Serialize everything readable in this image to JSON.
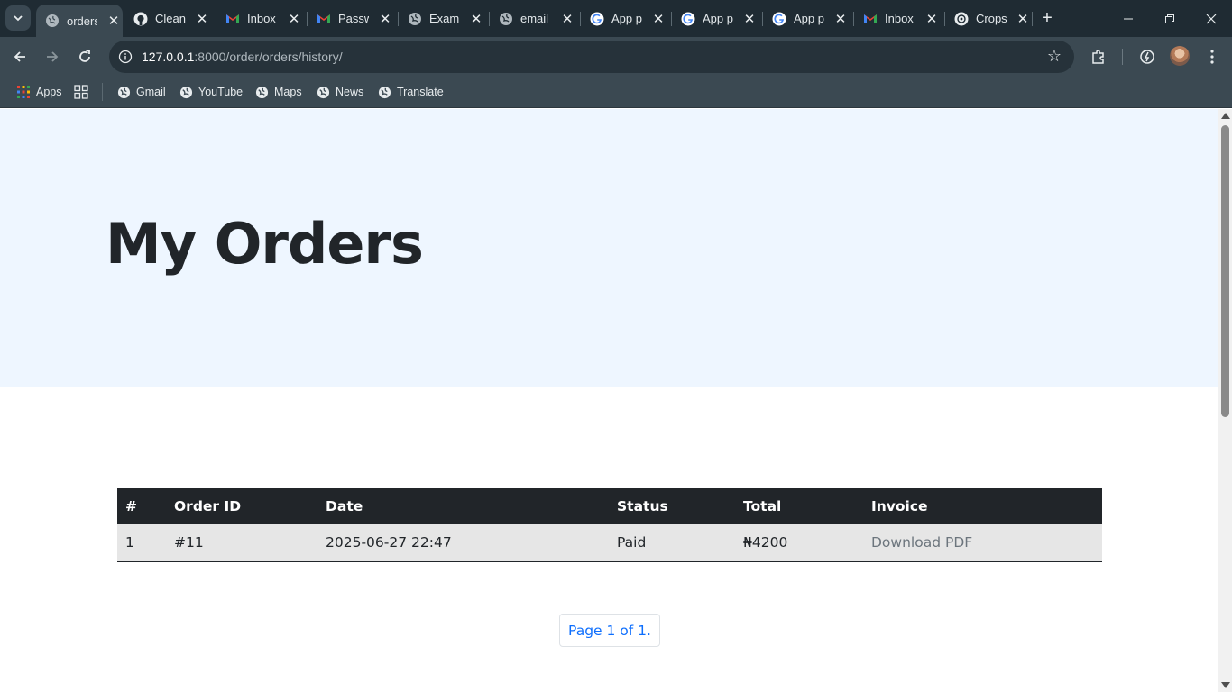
{
  "browser": {
    "tabs": [
      {
        "title": "orders",
        "icon": "globe-icon",
        "active": true
      },
      {
        "title": "Clean",
        "icon": "github-icon"
      },
      {
        "title": "Inbox",
        "icon": "gmail-icon"
      },
      {
        "title": "Passw",
        "icon": "gmail-icon"
      },
      {
        "title": "Examp",
        "icon": "globe-icon"
      },
      {
        "title": "email",
        "icon": "globe-icon"
      },
      {
        "title": "App p",
        "icon": "google-icon"
      },
      {
        "title": "App p",
        "icon": "google-icon"
      },
      {
        "title": "App p",
        "icon": "google-icon"
      },
      {
        "title": "Inbox",
        "icon": "gmail-icon"
      },
      {
        "title": "Crops",
        "icon": "openai-icon"
      }
    ],
    "url": {
      "host": "127.0.0.1",
      "path": ":8000/order/orders/history/"
    },
    "bookmarks": [
      {
        "label": "Apps",
        "icon": "apps-grid-icon"
      },
      {
        "label": "Gmail",
        "icon": "globe-icon"
      },
      {
        "label": "YouTube",
        "icon": "globe-icon"
      },
      {
        "label": "Maps",
        "icon": "globe-icon"
      },
      {
        "label": "News",
        "icon": "globe-icon"
      },
      {
        "label": "Translate",
        "icon": "globe-icon"
      }
    ]
  },
  "page": {
    "heading": "My Orders",
    "table": {
      "headers": [
        "#",
        "Order ID",
        "Date",
        "Status",
        "Total",
        "Invoice"
      ],
      "rows": [
        {
          "num": "1",
          "order_id": "#11",
          "date": "2025-06-27 22:47",
          "status": "Paid",
          "total": "₦4200",
          "invoice": "Download PDF"
        }
      ]
    },
    "pagination": "Page 1 of 1."
  },
  "colors": {
    "hero_bg": "#eef6ff",
    "table_header_bg": "#212529",
    "paid": "#198019",
    "link": "#0d6efd"
  }
}
